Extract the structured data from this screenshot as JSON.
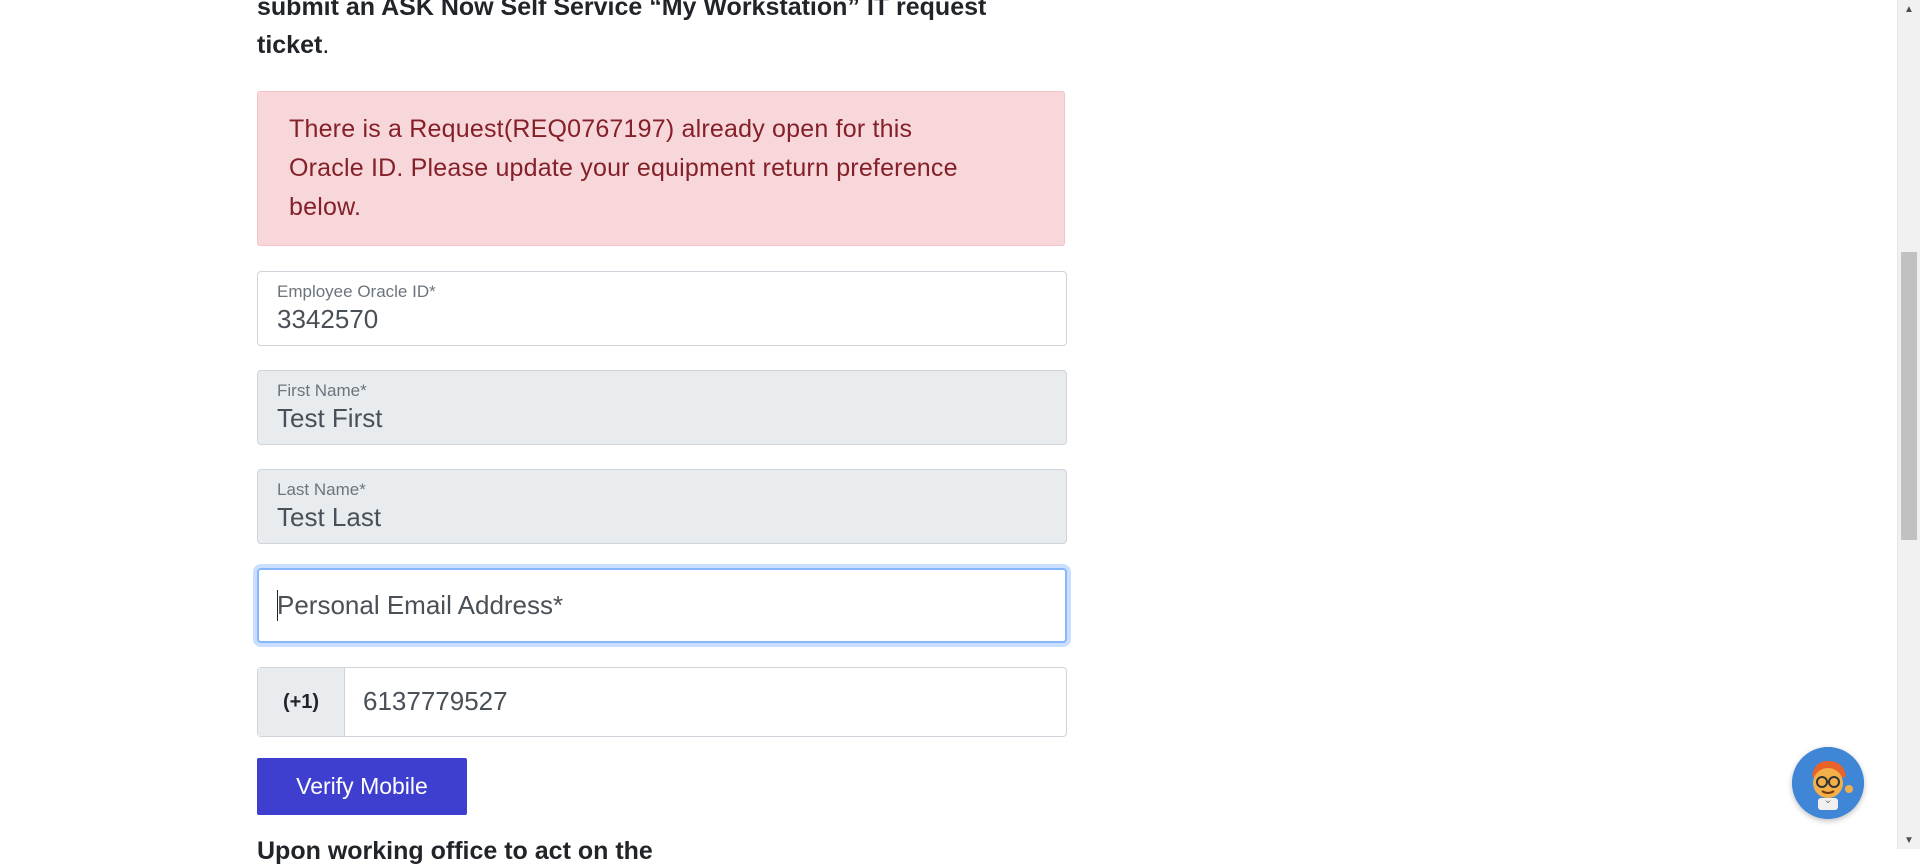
{
  "intro": {
    "line1": "submit an ASK Now Self Service “My Workstation” IT request",
    "line2": "ticket",
    "line2_punct": "."
  },
  "alert": {
    "message": "There is a Request(REQ0767197) already open for this Oracle ID. Please update your equipment return preference below."
  },
  "form": {
    "oracle_id": {
      "label": "Employee Oracle ID*",
      "value": "3342570"
    },
    "first_name": {
      "label": "First Name*",
      "value": "Test First"
    },
    "last_name": {
      "label": "Last Name*",
      "value": "Test Last"
    },
    "email": {
      "placeholder": "Personal Email Address*"
    },
    "phone": {
      "prefix": "(+1)",
      "value": "6137779527"
    },
    "verify_label": "Verify Mobile"
  },
  "cut_off_text": "Upon working office to act on the",
  "icons": {
    "chatbot": "chatbot-avatar-icon",
    "scroll_up": "triangle-up-icon",
    "scroll_down": "triangle-down-icon"
  },
  "colors": {
    "alert_bg": "#f8d7da",
    "alert_text": "#842029",
    "button_bg": "#3f3fcf",
    "focus_ring": "#86b7fe"
  }
}
